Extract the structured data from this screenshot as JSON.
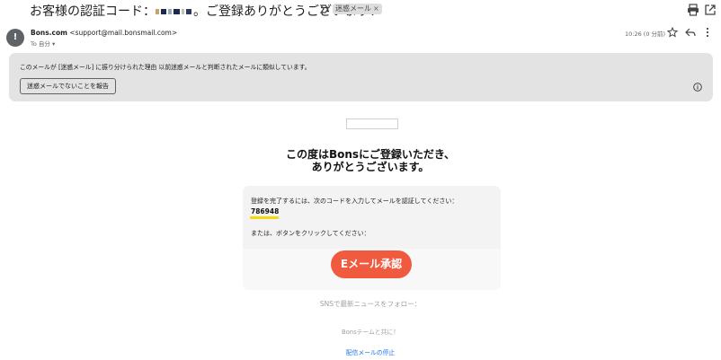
{
  "email": {
    "subject_prefix": "お客様の認証コード：",
    "subject_suffix": "。ご登録ありがとうございます！",
    "label": "迷惑メール",
    "label_close": "×",
    "sender_name": "Bons.com",
    "sender_email": "<support@mail.bonsmail.com>",
    "to": "To 自分",
    "time": "10:26 (0 分前)",
    "avatar_icon": "!"
  },
  "spam_banner": {
    "message": "このメールが [迷惑メール] に振り分けられた理由 以前迷惑メールと判断されたメールに類似しています。",
    "report_button": "迷惑メールでないことを報告"
  },
  "body": {
    "headline_line1": "この度はBonsにご登録いただき、",
    "headline_line2": "ありがとうございます。",
    "instruction": "登録を完了するには、次のコードを入力してメールを認証してください：",
    "code": "786948",
    "or_click": "または、ボタンをクリックしてください：",
    "verify_button": "Eメール承認",
    "sns_follow": "SNSで最新ニュースをフォロー：",
    "team": "Bonsテームと共に！",
    "unsubscribe": "配信メールの停止"
  },
  "colors": {
    "accent_button": "#f05a3f",
    "code_underline": "#f5d90a",
    "link": "#1a73e8",
    "spam_banner_bg": "#e3e3e3"
  },
  "icons": [
    "important-marker-icon",
    "print-icon",
    "open-in-new-window-icon",
    "star-icon",
    "reply-icon",
    "more-options-icon",
    "info-icon"
  ]
}
